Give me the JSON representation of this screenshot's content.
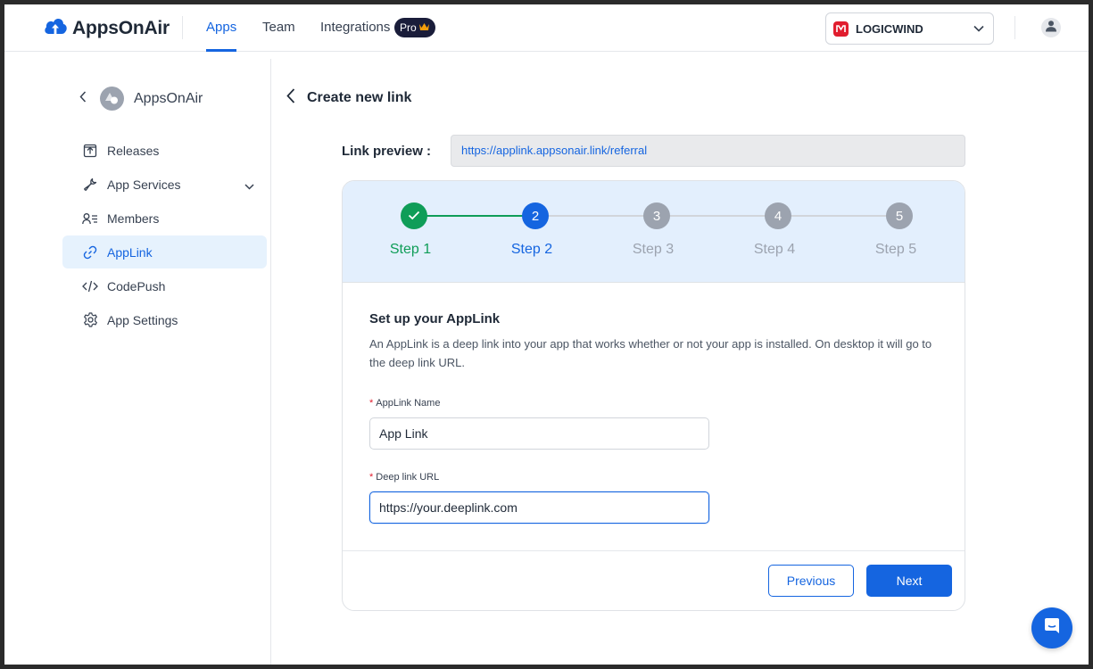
{
  "header": {
    "brand": "AppsOnAir",
    "nav": [
      {
        "label": "Apps",
        "active": true
      },
      {
        "label": "Team",
        "active": false
      },
      {
        "label": "Integrations",
        "active": false
      }
    ],
    "pro_badge": "Pro",
    "org_name": "LOGICWIND",
    "accent_color": "#1565e0"
  },
  "sidebar": {
    "app_name": "AppsOnAir",
    "items": [
      {
        "label": "Releases",
        "icon": "upload-box-icon"
      },
      {
        "label": "App Services",
        "icon": "wrench-icon",
        "expandable": true
      },
      {
        "label": "Members",
        "icon": "members-icon"
      },
      {
        "label": "AppLink",
        "icon": "link-icon",
        "active": true
      },
      {
        "label": "CodePush",
        "icon": "code-icon"
      },
      {
        "label": "App Settings",
        "icon": "gear-icon"
      }
    ]
  },
  "main": {
    "title": "Create new link",
    "preview_label": "Link preview :",
    "preview_url": "https://applink.appsonair.link/referral",
    "steps": [
      {
        "label": "Step 1",
        "number": "1",
        "state": "done"
      },
      {
        "label": "Step 2",
        "number": "2",
        "state": "current"
      },
      {
        "label": "Step 3",
        "number": "3",
        "state": "todo"
      },
      {
        "label": "Step 4",
        "number": "4",
        "state": "todo"
      },
      {
        "label": "Step 5",
        "number": "5",
        "state": "todo"
      }
    ],
    "section_title": "Set up your AppLink",
    "section_desc": "An AppLink is a deep link into your app that works whether or not your app is installed. On desktop it will go to the deep link URL.",
    "fields": {
      "name": {
        "label": "AppLink Name",
        "required_mark": "*",
        "value": "App Link"
      },
      "url": {
        "label": "Deep link URL",
        "required_mark": "*",
        "value": "https://your.deeplink.com"
      }
    },
    "buttons": {
      "previous": "Previous",
      "next": "Next"
    }
  },
  "colors": {
    "success": "#0f9d58",
    "inactive": "#9ca3af",
    "step_band": "#e3effd"
  }
}
